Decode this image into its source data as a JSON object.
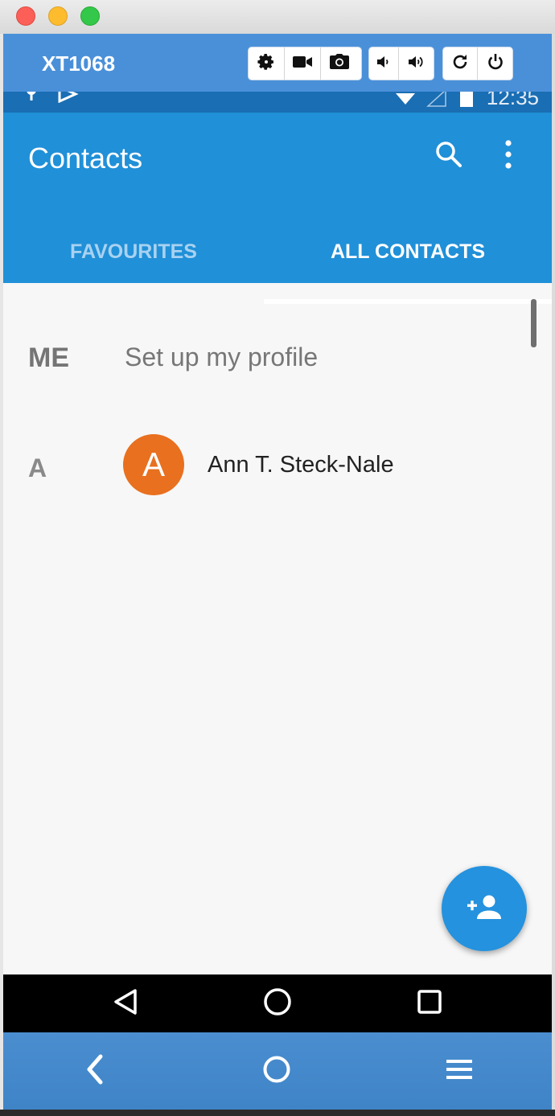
{
  "window": {
    "device_name": "XT1068",
    "toolbar_icons": [
      "gear-icon",
      "video-camera-icon",
      "camera-icon",
      "volume-down-icon",
      "volume-up-icon",
      "rotate-icon",
      "power-icon"
    ]
  },
  "status_bar": {
    "time": "12:35"
  },
  "app": {
    "title": "Contacts",
    "tabs": [
      {
        "label": "FAVOURITES",
        "selected": false
      },
      {
        "label": "ALL CONTACTS",
        "selected": true
      }
    ]
  },
  "contacts": {
    "me_label": "ME",
    "setup_profile": "Set up my profile",
    "sections": [
      {
        "letter": "A",
        "items": [
          {
            "initial": "A",
            "name": "Ann T. Steck-Nale",
            "avatar_color": "#e8701f"
          }
        ]
      }
    ]
  },
  "fab": {
    "icon": "add-person-icon"
  },
  "android_nav": [
    "back-triangle-icon",
    "home-circle-icon",
    "recents-square-icon"
  ],
  "host_nav": [
    "back-chevron-icon",
    "home-circle-icon",
    "menu-icon"
  ],
  "colors": {
    "toolbar": "#4a90d9",
    "appbar": "#2090d8",
    "status_bar": "#1a6eb3",
    "fab": "#2492de",
    "avatar": "#e8701f"
  }
}
